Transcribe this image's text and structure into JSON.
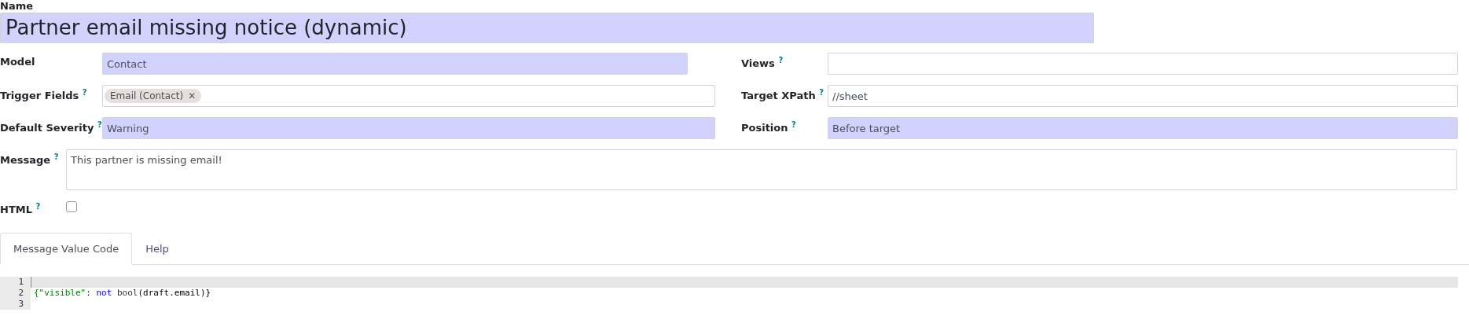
{
  "name_field": {
    "label": "Name",
    "value": "Partner email missing notice (dynamic)",
    "required": true
  },
  "left_fields": [
    {
      "label": "Model",
      "kind": "text",
      "value": "Contact",
      "required": true
    },
    {
      "label": "Trigger Fields",
      "help": "?",
      "kind": "tags",
      "tags": [
        {
          "label": "Email (Contact)",
          "remove": "✕"
        }
      ],
      "required": false
    },
    {
      "label": "Default Severity",
      "help": "?",
      "kind": "text",
      "value": "Warning",
      "required": true
    }
  ],
  "right_fields": [
    {
      "label": "Views",
      "help": "?",
      "kind": "text",
      "required": false
    },
    {
      "label": "Target XPath",
      "help": "?",
      "kind": "text",
      "value": "//sheet",
      "required": false
    },
    {
      "label": "Position",
      "help": "?",
      "kind": "text",
      "value": "Before target",
      "required": true
    }
  ],
  "message": {
    "label": "Message",
    "help": "?",
    "value": "This partner is missing email!"
  },
  "html": {
    "label": "HTML",
    "help": "?",
    "checked": false
  },
  "tabs": [
    {
      "label": "Message Value Code",
      "selected": true
    },
    {
      "label": "Help",
      "selected": false
    }
  ],
  "code": {
    "lines": [
      {
        "number": "1",
        "active": true
      },
      {
        "number": "2",
        "active": false,
        "tokens": [
          {
            "kind": "string",
            "text": "{\"visible\""
          },
          {
            "kind": "plain",
            "text": ": "
          },
          {
            "kind": "keyword",
            "text": "not"
          },
          {
            "kind": "builtin",
            "text": " bool"
          },
          {
            "kind": "plain",
            "text": "(draft.email)}"
          }
        ]
      },
      {
        "number": "3",
        "active": false
      }
    ]
  }
}
